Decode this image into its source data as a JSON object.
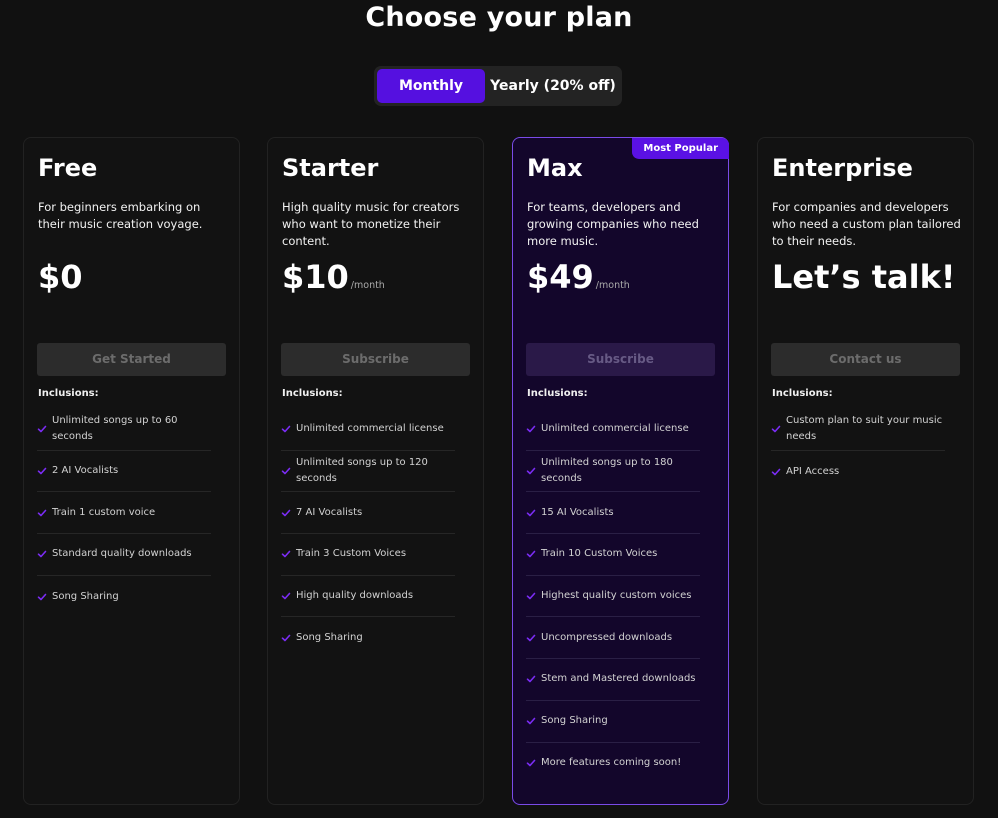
{
  "page": {
    "title": "Choose your plan"
  },
  "billing_toggle": {
    "monthly_label": "Monthly",
    "yearly_label": "Yearly (20% off)",
    "selected": "Monthly"
  },
  "colors": {
    "accent": "#5510e0",
    "background": "#111111",
    "featured_card_bg": "#13062b",
    "featured_border": "#7a4be8",
    "check": "#7b2cf5"
  },
  "plans": [
    {
      "name": "Free",
      "description": "For beginners embarking on their music creation voyage.",
      "price": "$0",
      "period": "",
      "cta": "Get Started",
      "inclusions_label": "Inclusions:",
      "features": [
        "Unlimited songs up to 60 seconds",
        "2 AI Vocalists",
        "Train 1 custom voice",
        "Standard quality downloads",
        "Song Sharing"
      ]
    },
    {
      "name": "Starter",
      "description": "High quality music for creators who want to monetize their content.",
      "price": "$10",
      "period": "/month",
      "cta": "Subscribe",
      "inclusions_label": "Inclusions:",
      "features": [
        "Unlimited commercial license",
        "Unlimited songs up to 120 seconds",
        "7 AI Vocalists",
        "Train 3 Custom Voices",
        "High quality downloads",
        "Song Sharing"
      ]
    },
    {
      "name": "Max",
      "badge": "Most Popular",
      "description": "For teams, developers and growing companies who need more music.",
      "price": "$49",
      "period": "/month",
      "cta": "Subscribe",
      "inclusions_label": "Inclusions:",
      "features": [
        "Unlimited commercial license",
        "Unlimited songs up to 180 seconds",
        "15 AI Vocalists",
        "Train 10 Custom Voices",
        "Highest quality custom voices",
        "Uncompressed downloads",
        "Stem and Mastered downloads",
        "Song Sharing",
        "More features coming soon!"
      ]
    },
    {
      "name": "Enterprise",
      "description": "For companies and developers who need a custom plan tailored to their needs.",
      "price": "Let’s talk!",
      "period": "",
      "cta": "Contact us",
      "inclusions_label": "Inclusions:",
      "features": [
        "Custom plan to suit your music needs",
        "API Access"
      ]
    }
  ]
}
